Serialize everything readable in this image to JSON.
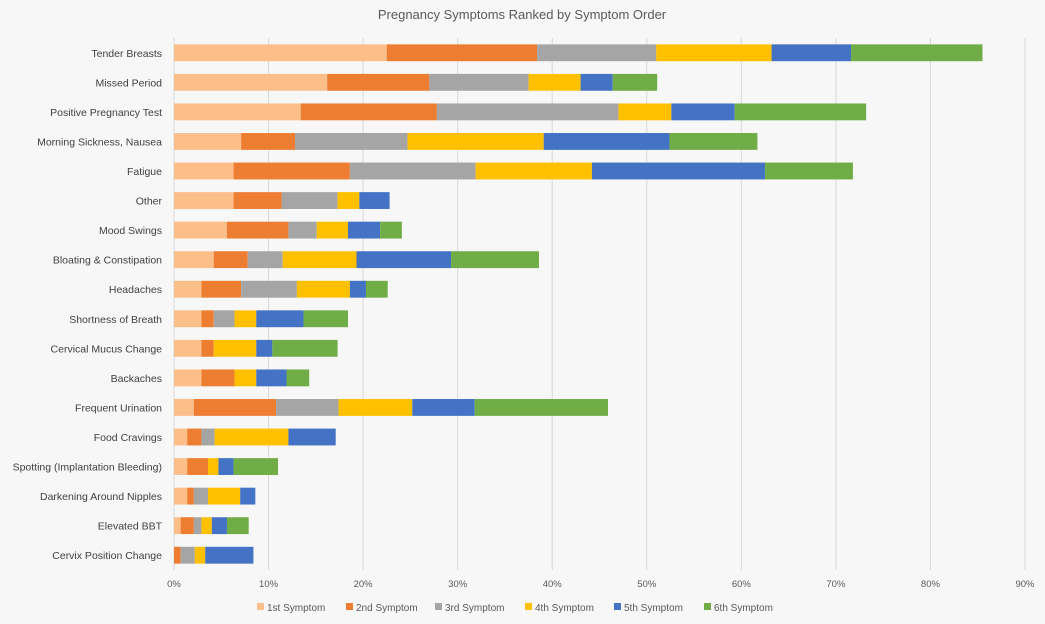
{
  "chart_data": {
    "type": "bar",
    "orientation": "horizontal",
    "stacked": true,
    "title": "Pregnancy Symptoms Ranked by Symptom Order",
    "xlabel": "",
    "ylabel": "",
    "xlim": [
      0,
      90
    ],
    "x_ticks": [
      "0%",
      "10%",
      "20%",
      "30%",
      "40%",
      "50%",
      "60%",
      "70%",
      "80%",
      "90%"
    ],
    "x_tick_values": [
      0,
      10,
      20,
      30,
      40,
      50,
      60,
      70,
      80,
      90
    ],
    "grid": "vertical",
    "legend_position": "bottom",
    "categories": [
      "Tender Breasts",
      "Missed Period",
      "Positive Pregnancy Test",
      "Morning Sickness, Nausea",
      "Fatigue",
      "Other",
      "Mood Swings",
      "Bloating & Constipation",
      "Headaches",
      "Shortness of Breath",
      "Cervical Mucus Change",
      "Backaches",
      "Frequent Urination",
      "Food Cravings",
      "Spotting (Implantation Bleeding)",
      "Darkening Around Nipples",
      "Elevated BBT",
      "Cervix Position Change"
    ],
    "series": [
      {
        "name": "1st Symptom",
        "color": "#fdbf8a",
        "values": [
          22.5,
          16.2,
          13.4,
          7.1,
          6.3,
          6.3,
          5.6,
          4.2,
          2.9,
          2.9,
          2.9,
          2.9,
          2.1,
          1.4,
          1.4,
          1.4,
          0.7,
          0.0
        ]
      },
      {
        "name": "2nd Symptom",
        "color": "#ed7d31",
        "values": [
          15.9,
          10.8,
          14.4,
          5.7,
          12.3,
          5.1,
          6.5,
          3.6,
          4.2,
          1.3,
          1.3,
          3.5,
          8.7,
          1.5,
          2.2,
          0.7,
          1.4,
          0.7
        ]
      },
      {
        "name": "3rd Symptom",
        "color": "#a5a5a5",
        "values": [
          12.6,
          10.5,
          19.2,
          11.9,
          13.3,
          5.9,
          3.0,
          3.7,
          5.9,
          2.2,
          0.0,
          0.0,
          6.6,
          1.4,
          0.0,
          1.5,
          0.8,
          1.5
        ]
      },
      {
        "name": "4th Symptom",
        "color": "#ffc000",
        "values": [
          12.2,
          5.5,
          5.6,
          14.4,
          12.3,
          2.3,
          3.3,
          7.8,
          5.6,
          2.3,
          4.5,
          2.3,
          7.8,
          7.8,
          1.1,
          3.4,
          1.1,
          1.1
        ]
      },
      {
        "name": "5th Symptom",
        "color": "#4472c4",
        "values": [
          8.4,
          3.4,
          6.7,
          13.3,
          18.3,
          3.2,
          3.4,
          10.0,
          1.7,
          5.0,
          1.7,
          3.2,
          6.6,
          5.0,
          1.6,
          1.6,
          1.6,
          5.1
        ]
      },
      {
        "name": "6th Symptom",
        "color": "#70ad47",
        "values": [
          13.9,
          4.7,
          13.9,
          9.3,
          9.3,
          0.0,
          2.3,
          9.3,
          2.3,
          4.7,
          6.9,
          2.4,
          14.1,
          0.0,
          4.7,
          0.0,
          2.3,
          0.0
        ]
      }
    ]
  }
}
